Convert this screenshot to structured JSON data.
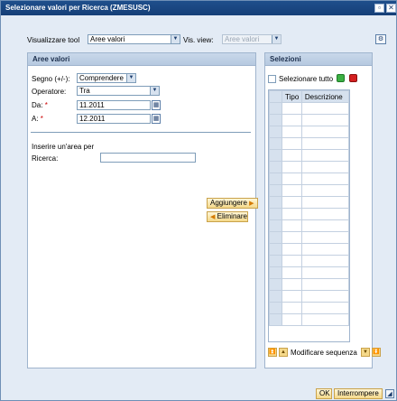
{
  "window": {
    "title": "Selezionare valori per Ricerca (ZMESUSC)"
  },
  "toolbar": {
    "view_label": "Visualizzare tool",
    "view_value": "Aree valori",
    "vis_view_label": "Vis. view:",
    "vis_view_value": "Aree valori"
  },
  "left_panel": {
    "title": "Aree valori",
    "sign_label": "Segno (+/-):",
    "sign_value": "Comprendere",
    "operator_label": "Operatore:",
    "operator_value": "Tra",
    "from_label": "Da:",
    "from_value": "11.2011",
    "to_label": "A:",
    "to_value": "12.2011",
    "area_hint": "Inserire un'area per",
    "search_label": "Ricerca:",
    "search_value": "",
    "required_mark": "*"
  },
  "middle": {
    "add_label": "Aggiungere",
    "remove_label": "Eliminare"
  },
  "right_panel": {
    "title": "Selezioni",
    "select_all_label": "Selezionare tutto",
    "columns": [
      "Tipo",
      "Descrizione"
    ],
    "sequence_label": "Modificare sequenza"
  },
  "footer": {
    "ok_label": "OK",
    "cancel_label": "Interrompere"
  },
  "colors": {
    "title_bar": "#1f4f8c",
    "green_status": "#3cb043",
    "red_status": "#d42020"
  }
}
